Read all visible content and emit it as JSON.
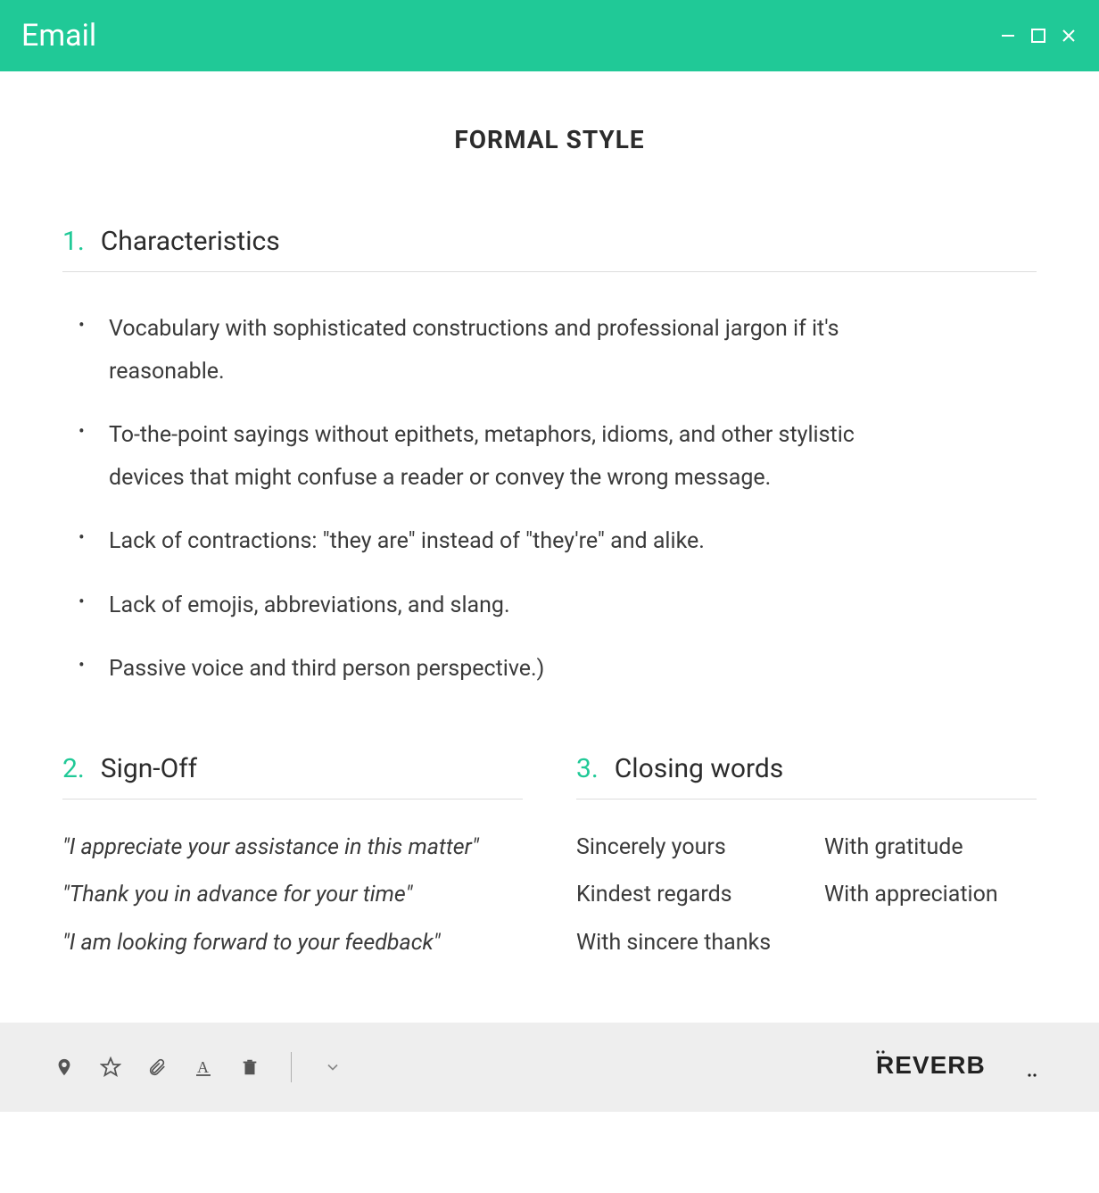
{
  "window": {
    "title": "Email"
  },
  "page_title": "FORMAL STYLE",
  "sections": {
    "characteristics": {
      "num": "1.",
      "label": "Characteristics",
      "items": [
        "Vocabulary with sophisticated constructions and professional jargon if it's reasonable.",
        "To-the-point sayings without epithets, metaphors, idioms, and other stylistic devices that might confuse a reader or convey the wrong message.",
        "Lack of contractions: \"they are\" instead of \"they're\" and alike.",
        "Lack of emojis, abbreviations, and slang.",
        "Passive voice and third person perspective.)"
      ]
    },
    "signoff": {
      "num": "2.",
      "label": "Sign-Off",
      "items": [
        "\"I appreciate your assistance in this matter\"",
        "\"Thank you in advance for your time\"",
        "\"I am looking forward to your feedback\""
      ]
    },
    "closing": {
      "num": "3.",
      "label": "Closing words",
      "col1": [
        "Sincerely yours",
        "Kindest regards",
        "With sincere thanks"
      ],
      "col2": [
        "With gratitude",
        "With appreciation"
      ]
    }
  },
  "brand": "REVERB",
  "colors": {
    "accent": "#20c997"
  }
}
